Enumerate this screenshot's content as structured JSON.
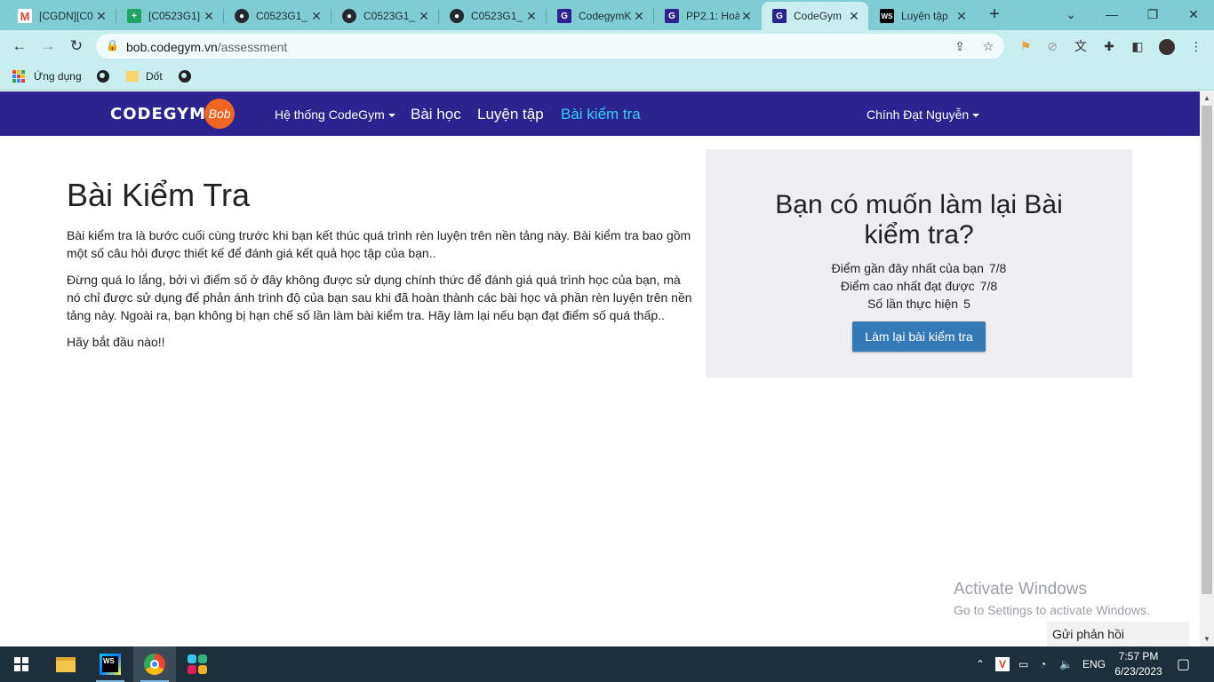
{
  "browser": {
    "tabs": [
      {
        "title": "[CGDN][C0",
        "favicon": "gmail-icon",
        "color": "#ea4335"
      },
      {
        "title": "[C0523G1]",
        "favicon": "sheets-icon",
        "color": "#1fa463"
      },
      {
        "title": "C0523G1_",
        "favicon": "github-icon",
        "color": "#24292e"
      },
      {
        "title": "C0523G1_",
        "favicon": "github-icon",
        "color": "#24292e"
      },
      {
        "title": "C0523G1_",
        "favicon": "github-icon",
        "color": "#24292e"
      },
      {
        "title": "CodegymK",
        "favicon": "codegym-icon",
        "color": "#2b2390"
      },
      {
        "title": "PP2.1: Hoà",
        "favicon": "codegym-icon",
        "color": "#2b2390"
      },
      {
        "title": "CodeGym",
        "favicon": "codegym-icon",
        "color": "#2b2390",
        "active": true
      },
      {
        "title": "Luyện tập",
        "favicon": "webstorm-icon",
        "color": "#000000"
      }
    ],
    "url_host": "bob.codegym.vn",
    "url_path": "/assessment",
    "bookmarks": [
      {
        "label": "Ứng dụng",
        "icon": "apps-grid-icon"
      },
      {
        "label": "",
        "icon": "globe-icon"
      },
      {
        "label": "Dốt",
        "icon": "folder-icon"
      },
      {
        "label": "",
        "icon": "globe-icon"
      }
    ]
  },
  "site": {
    "logo_text": "CODEGYM",
    "logo_badge": "Bob",
    "nav": {
      "system": "Hệ thống CodeGym",
      "lessons": "Bài học",
      "practice": "Luyện tập",
      "assessment": "Bài kiểm tra",
      "user": "Chính Đạt Nguyễn"
    },
    "accent": "#2b2390",
    "active_color": "#35d0f0"
  },
  "main": {
    "title": "Bài Kiểm Tra",
    "paragraphs": [
      "Bài kiểm tra là bước cuối cùng trước khi bạn kết thúc quá trình rèn luyện trên nền tảng này. Bài kiểm tra bao gồm một số câu hỏi được thiết kế để đánh giá kết quả học tập của bạn..",
      "Đừng quá lo lắng, bởi vì điểm số ở đây không được sử dụng chính thức để đánh giá quá trình học của bạn, mà nó chỉ được sử dụng để phản ánh trình độ của bạn sau khi đã hoàn thành các bài học và phần rèn luyện trên nền tảng này. Ngoài ra, bạn không bị hạn chế số lần làm bài kiểm tra. Hãy làm lại nếu bạn đạt điểm số quá thấp..",
      "Hãy bắt đầu nào!!"
    ]
  },
  "panel": {
    "heading": "Bạn có muốn làm lại Bài kiểm tra?",
    "latest_label": "Điểm gần đây nhất của bạn",
    "latest_value": "7/8",
    "best_label": "Điểm cao nhất đạt được",
    "best_value": "7/8",
    "attempts_label": "Số lần thực hiện",
    "attempts_value": "5",
    "retry_button": "Làm lại bài kiểm tra",
    "button_color": "#337ab7"
  },
  "overlay": {
    "activate_title": "Activate Windows",
    "activate_sub": "Go to Settings to activate Windows.",
    "feedback": "Gửi phản hồi"
  },
  "taskbar": {
    "lang": "ENG",
    "time": "7:57 PM",
    "date": "6/23/2023"
  }
}
